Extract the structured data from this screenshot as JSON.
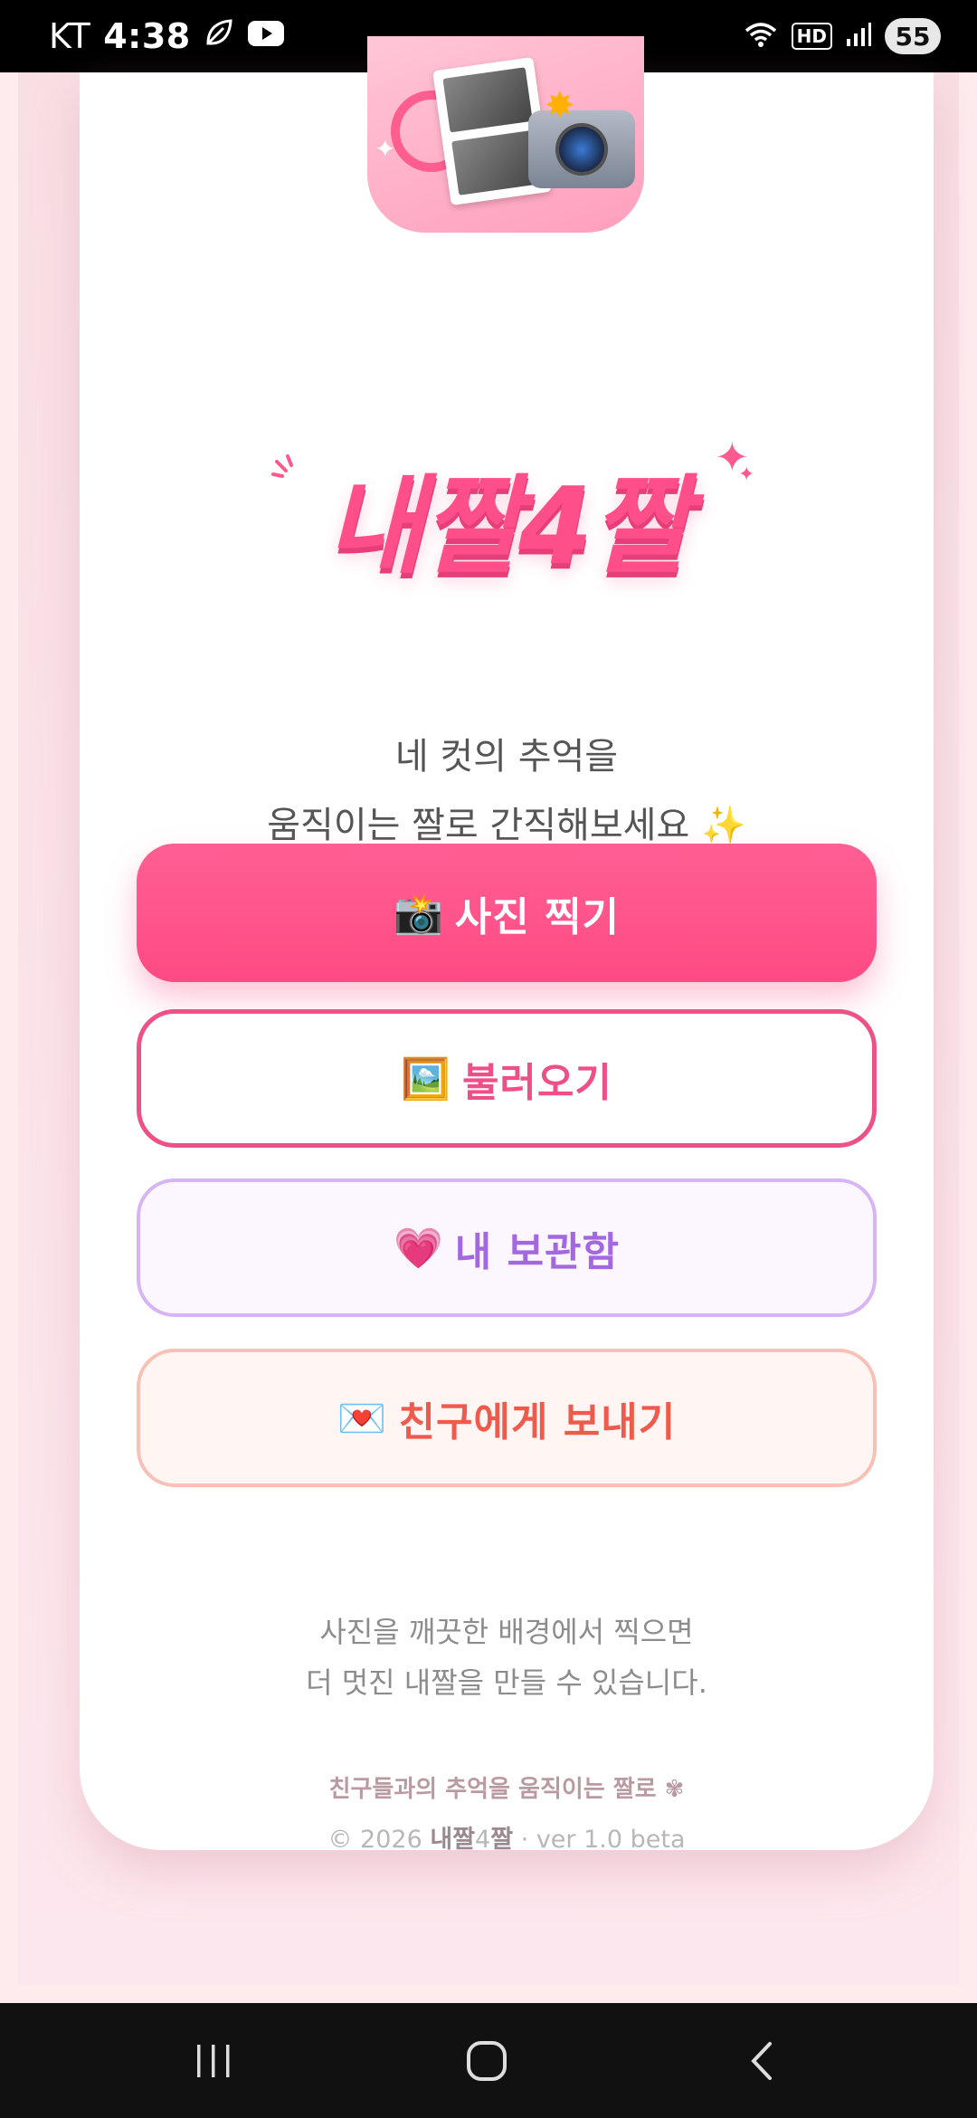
{
  "status_bar": {
    "carrier": "KT",
    "time": "4:38",
    "hd": "HD",
    "battery": "55",
    "icons": [
      "leaf-icon",
      "youtube-icon",
      "wifi-icon",
      "signal-icon"
    ]
  },
  "tagline": {
    "line1": "네 컷의 추억을",
    "line2": "움직이는 짤로 간직해보세요 ✨"
  },
  "logo": {
    "text": "내짤4짤"
  },
  "buttons": {
    "camera": {
      "icon": "📸",
      "label": "사진 찍기"
    },
    "load": {
      "icon": "🖼️",
      "label": "불러오기"
    },
    "box": {
      "icon": "💗",
      "label": "내 보관함"
    },
    "send": {
      "icon": "💌",
      "label": "친구에게 보내기"
    }
  },
  "tip": {
    "line1": "사진을 깨끗한 배경에서 찍으면",
    "line2": "더 멋진 내짤을 만들 수 있습니다."
  },
  "footer": {
    "tagline": "친구들과의 추억을 움직이는 짤로 ✾",
    "copyright_prefix": "© 2026 ",
    "brand_a": "내짤",
    "brand_b": "4",
    "brand_c": "짤",
    "version": " · ver 1.0 beta"
  },
  "colors": {
    "accent": "#ff4f8a",
    "purple": "#a368e0",
    "coral": "#ef5a4d"
  }
}
